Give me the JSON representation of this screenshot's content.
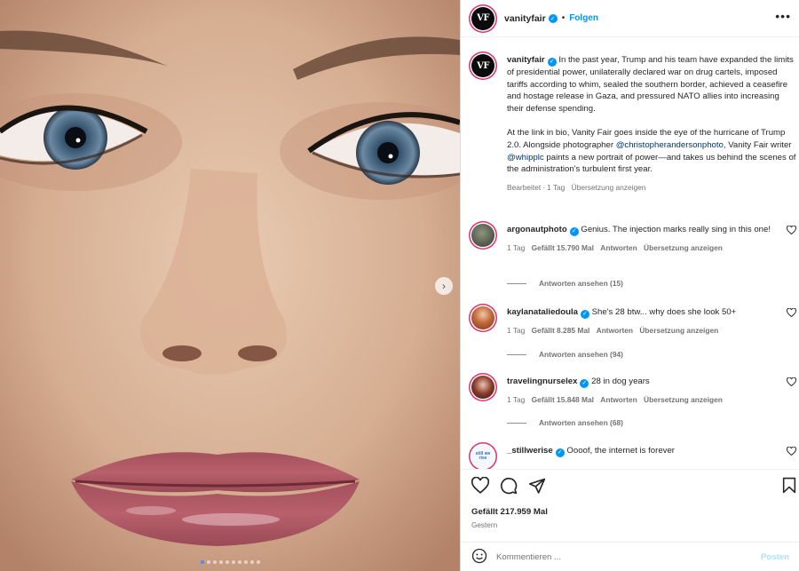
{
  "post": {
    "username": "vanityfair",
    "avatar_text": "VF",
    "separator": "•",
    "follow_label": "Folgen",
    "more_label": "•••"
  },
  "caption": {
    "username": "vanityfair",
    "text1": "In the past year, Trump and his team have expanded the limits of presidential power, unilaterally declared war on drug cartels, imposed tariffs according to whim, sealed the southern border, achieved a ceasefire and hostage release in Gaza, and pressured NATO allies into increasing their defense spending.",
    "text2a": "At the link in bio, Vanity Fair goes inside the eye of the hurricane of Trump 2.0. Alongside photographer ",
    "mention1": "@christopherandersonphoto",
    "text2b": ", Vanity Fair writer ",
    "mention2": "@whipplc",
    "text2c": " paints a new portrait of power—and takes us behind the scenes of the administration's turbulent first year.",
    "edited": "Bearbeitet",
    "dot": "·",
    "time": "1 Tag",
    "translate": "Übersetzung anzeigen"
  },
  "comments": [
    {
      "username": "argonautphoto",
      "text": "Genius. The injection marks really sing in this one!",
      "time": "1 Tag",
      "likes": "Gefällt 15.790 Mal",
      "reply": "Antworten",
      "translate": "Übersetzung anzeigen",
      "view_replies": "Antworten ansehen (15)"
    },
    {
      "username": "kaylanataliedoula",
      "text": "She's 28 btw... why does she look 50+",
      "time": "1 Tag",
      "likes": "Gefällt 8.285 Mal",
      "reply": "Antworten",
      "translate": "Übersetzung anzeigen",
      "view_replies": "Antworten ansehen (94)"
    },
    {
      "username": "travelingnurselex",
      "text": "28 in dog years",
      "time": "1 Tag",
      "likes": "Gefällt 15.848 Mal",
      "reply": "Antworten",
      "translate": "Übersetzung anzeigen",
      "view_replies": "Antworten ansehen (68)"
    },
    {
      "username": "_stillwerise",
      "text": "Oooof, the internet is forever",
      "avatar_text": "still we rise"
    }
  ],
  "footer": {
    "likes": "Gefällt 217.959 Mal",
    "date": "Gestern",
    "comment_placeholder": "Kommentieren ...",
    "post_label": "Posten"
  },
  "carousel": {
    "slide_count": 10,
    "active_index": 0
  },
  "colors": {
    "accent": "#0095f6",
    "link": "#00376b",
    "story_ring": "#e1306c",
    "muted": "#737373"
  },
  "icons": [
    "heart-icon",
    "comment-icon",
    "share-icon",
    "bookmark-icon",
    "emoji-icon",
    "verified-icon",
    "chevron-right-icon"
  ]
}
